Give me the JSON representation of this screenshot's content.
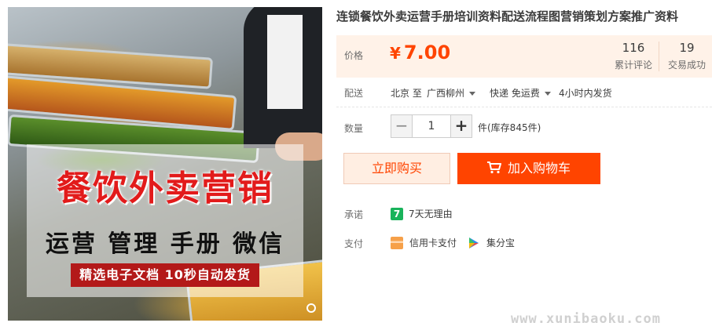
{
  "product": {
    "title": "连锁餐饮外卖运营手册培训资料配送流程图营销策划方案推广资料",
    "image": {
      "headline": "餐饮外卖营销",
      "subline": "运营 管理 手册 微信",
      "tag": "精选电子文档 10秒自动发货"
    }
  },
  "price": {
    "label": "价格",
    "currency": "¥",
    "value": "7.00",
    "reviews_count": "116",
    "reviews_label": "累计评论",
    "sales_count": "19",
    "sales_label": "交易成功"
  },
  "shipping": {
    "label": "配送",
    "from": "北京 至",
    "to": "广西柳州",
    "method": "快递 免运费",
    "dispatch": "4小时内发货"
  },
  "quantity": {
    "label": "数量",
    "value": "1",
    "minus": "−",
    "plus": "+",
    "stock": "件(库存845件)"
  },
  "actions": {
    "buy_now": "立即购买",
    "add_to_cart": "加入购物车"
  },
  "promise": {
    "label": "承诺",
    "badge": "7",
    "text": "7天无理由"
  },
  "payment": {
    "label": "支付",
    "methods": [
      "信用卡支付",
      "集分宝"
    ]
  },
  "watermark": "www.xunibaoku.com",
  "colors": {
    "accent": "#ff4400",
    "price_bg": "#fff2e8",
    "buy_bg": "#ffeee2",
    "promise_green": "#19b35b",
    "banner_red": "#e21b1b",
    "tag_red": "#b31919"
  },
  "icons": {
    "cart": "shopping-cart-icon",
    "caret": "chevron-down-icon",
    "credit_card": "credit-card-icon",
    "jifenbao": "jifenbao-icon"
  }
}
